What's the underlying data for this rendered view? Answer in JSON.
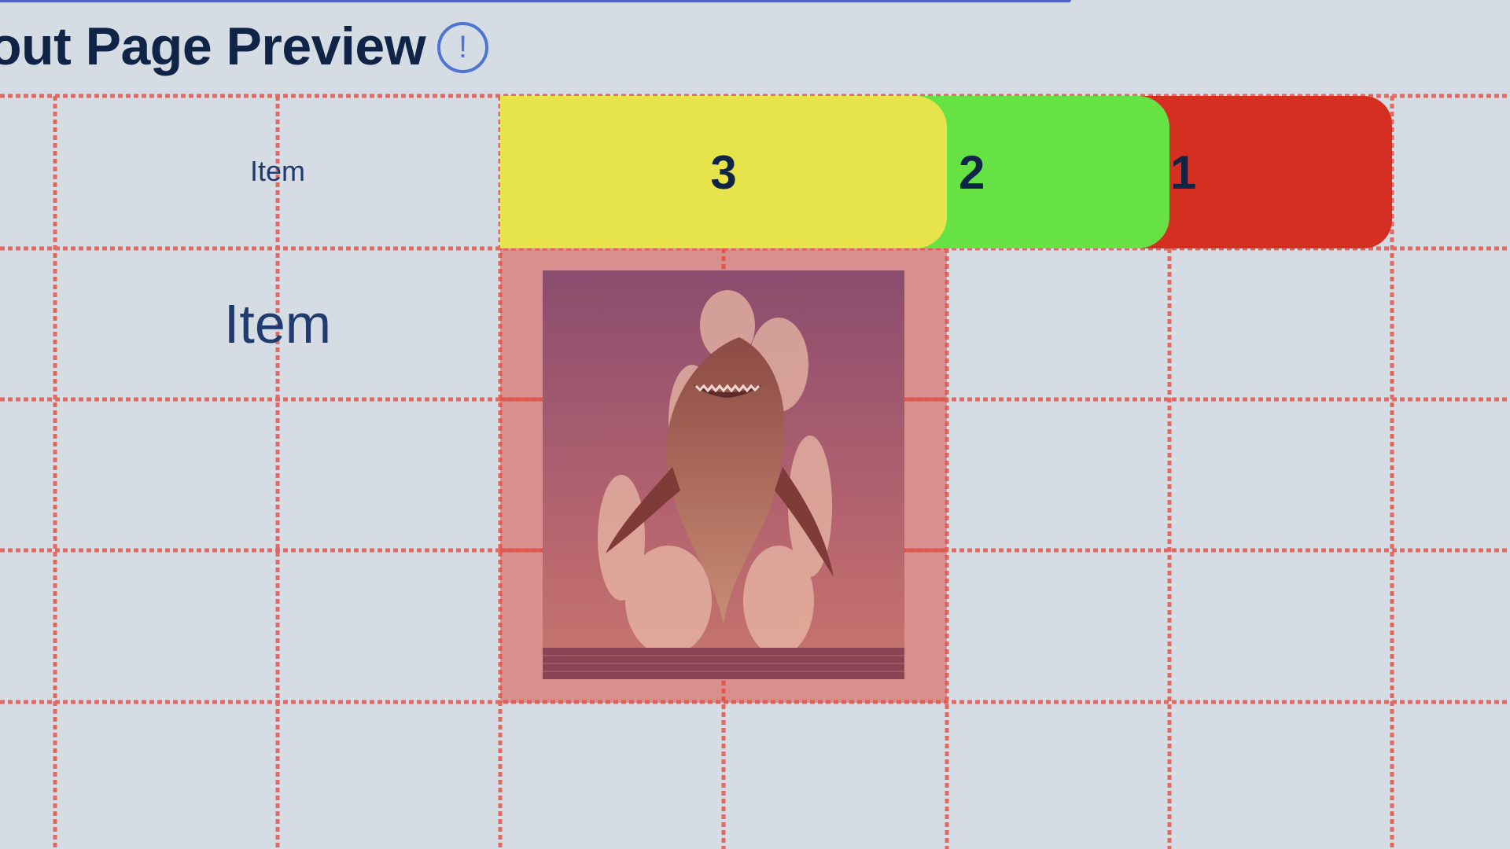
{
  "header": {
    "title": "out Page Preview",
    "info_icon": "info-icon",
    "info_glyph": "!"
  },
  "grid": {
    "row_labels": [
      "Item",
      "Item"
    ]
  },
  "segments": [
    {
      "label": "3",
      "color": "#e6e34b"
    },
    {
      "label": "2",
      "color": "#66e245"
    },
    {
      "label": "1",
      "color": "#d42f20"
    }
  ],
  "selected_cell": {
    "overlay_color": "#dc5046",
    "image_subject": "shark-breaching-photo"
  },
  "colors": {
    "background": "#d5dce4",
    "grid_line": "#e06a62",
    "title": "#0f2447",
    "accent": "#4e74d6"
  }
}
